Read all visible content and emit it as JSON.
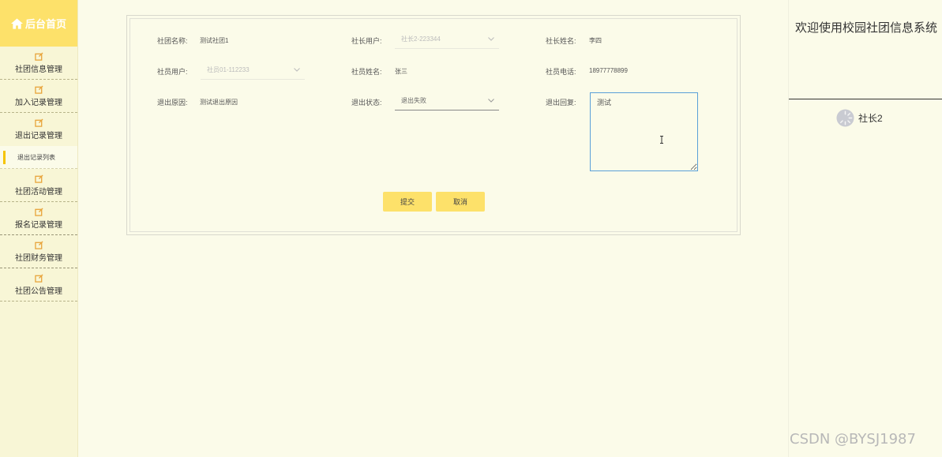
{
  "sidebar": {
    "home_label": "后台首页",
    "items": [
      {
        "label": "社团信息管理"
      },
      {
        "label": "加入记录管理"
      },
      {
        "label": "退出记录管理"
      },
      {
        "label": "社团活动管理"
      },
      {
        "label": "报名记录管理"
      },
      {
        "label": "社团财务管理"
      },
      {
        "label": "社团公告管理"
      }
    ],
    "submenu_label": "退出记录列表",
    "accent_color": "#fde16a"
  },
  "form": {
    "club_name": {
      "label": "社团名称:",
      "value": "测试社团1"
    },
    "president_user": {
      "label": "社长用户:",
      "value": "社长2-223344"
    },
    "president_name": {
      "label": "社长姓名:",
      "value": "李四"
    },
    "member_user": {
      "label": "社员用户:",
      "value": "社员01-112233"
    },
    "member_name": {
      "label": "社员姓名:",
      "value": "张三"
    },
    "member_phone": {
      "label": "社员电话:",
      "value": "18977778899"
    },
    "exit_reason": {
      "label": "退出原因:",
      "value": "测试退出原因"
    },
    "exit_status": {
      "label": "退出状态:",
      "value": "退出失败"
    },
    "exit_reply": {
      "label": "退出回复:",
      "value": "测试"
    },
    "submit_label": "提交",
    "cancel_label": "取消"
  },
  "header": {
    "welcome": "欢迎使用校园社团信息系统",
    "username": "社长2"
  },
  "watermark": "CSDN @BYSJ1987"
}
